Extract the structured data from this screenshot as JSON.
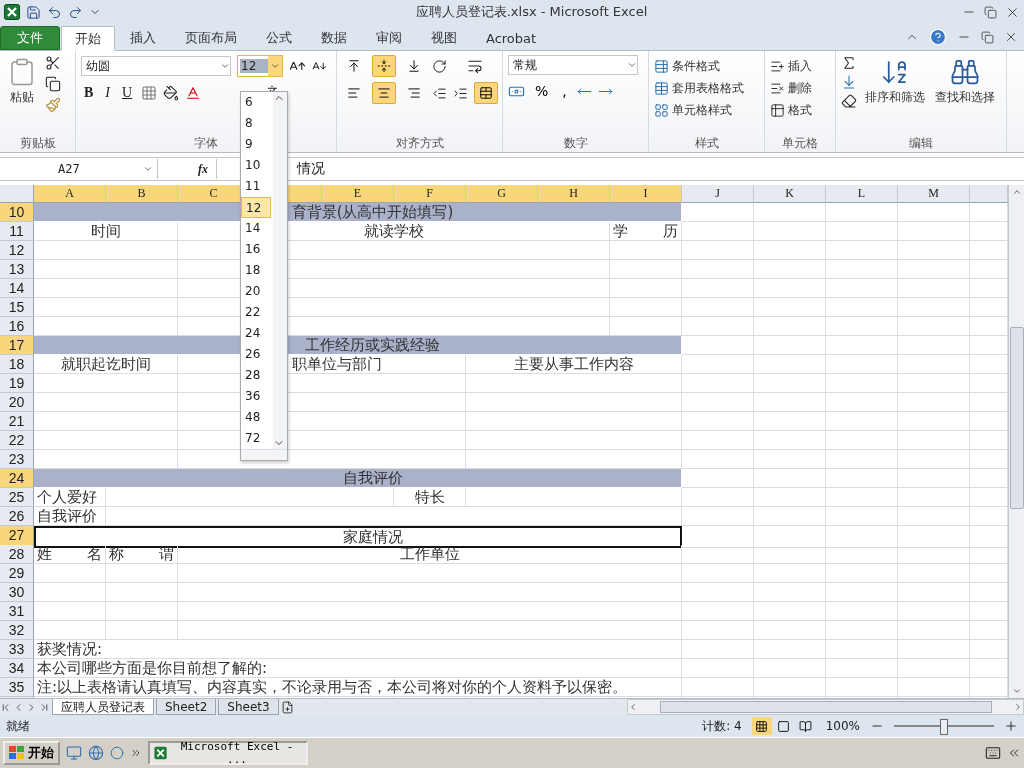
{
  "window": {
    "title": "应聘人员登记表.xlsx - Microsoft Excel"
  },
  "tabs": [
    {
      "label": "文件",
      "kind": "file",
      "selected": false
    },
    {
      "label": "开始",
      "kind": "tab",
      "selected": true
    },
    {
      "label": "插入",
      "kind": "tab",
      "selected": false
    },
    {
      "label": "页面布局",
      "kind": "tab",
      "selected": false
    },
    {
      "label": "公式",
      "kind": "tab",
      "selected": false
    },
    {
      "label": "数据",
      "kind": "tab",
      "selected": false
    },
    {
      "label": "审阅",
      "kind": "tab",
      "selected": false
    },
    {
      "label": "视图",
      "kind": "tab",
      "selected": false
    },
    {
      "label": "Acrobat",
      "kind": "tab",
      "selected": false
    }
  ],
  "ribbon": {
    "clipboard": {
      "paste": "粘贴",
      "label": "剪贴板"
    },
    "font": {
      "name": "幼圆",
      "size": "12",
      "styles": [
        "B",
        "I",
        "U"
      ],
      "label": "字体"
    },
    "alignment": {
      "label": "对齐方式",
      "vertical": [
        {
          "selected": false
        },
        {
          "selected": true
        },
        {
          "selected": false
        }
      ],
      "horizontal": [
        {
          "selected": false
        },
        {
          "selected": true
        },
        {
          "selected": false
        }
      ],
      "merge": {
        "selected": true
      }
    },
    "number": {
      "format": "常规",
      "percent": "%",
      "comma": ",",
      "label": "数字"
    },
    "styles": {
      "items": [
        "条件格式",
        "套用表格格式",
        "单元格样式"
      ],
      "label": "样式"
    },
    "cells": {
      "items": [
        "插入",
        "删除",
        "格式"
      ],
      "label": "单元格"
    },
    "editing": {
      "sort": "排序和筛选",
      "find": "查找和选择",
      "label": "编辑"
    }
  },
  "formula_bar": {
    "name_box": "A27",
    "function_label": "fx",
    "content": "情况"
  },
  "font_size_list": [
    {
      "label": "6",
      "selected": false
    },
    {
      "label": "8",
      "selected": false
    },
    {
      "label": "9",
      "selected": false
    },
    {
      "label": "10",
      "selected": false
    },
    {
      "label": "11",
      "selected": false
    },
    {
      "label": "12",
      "selected": true
    },
    {
      "label": "14",
      "selected": false
    },
    {
      "label": "16",
      "selected": false
    },
    {
      "label": "18",
      "selected": false
    },
    {
      "label": "20",
      "selected": false
    },
    {
      "label": "22",
      "selected": false
    },
    {
      "label": "24",
      "selected": false
    },
    {
      "label": "26",
      "selected": false
    },
    {
      "label": "28",
      "selected": false
    },
    {
      "label": "36",
      "selected": false
    },
    {
      "label": "48",
      "selected": false
    },
    {
      "label": "72",
      "selected": false
    }
  ],
  "columns": [
    {
      "label": "A",
      "selected": true
    },
    {
      "label": "B",
      "selected": true
    },
    {
      "label": "C",
      "selected": true
    },
    {
      "selected": true
    },
    {
      "label": "E",
      "selected": true
    },
    {
      "label": "F",
      "selected": true
    },
    {
      "label": "G",
      "selected": true
    },
    {
      "label": "H",
      "selected": true
    },
    {
      "label": "I",
      "selected": true
    },
    {
      "label": "J",
      "selected": false
    },
    {
      "label": "K",
      "selected": false
    },
    {
      "label": "L",
      "selected": false
    },
    {
      "label": "M",
      "selected": false
    }
  ],
  "rows": [
    {
      "number": "10",
      "selected": true,
      "active": false,
      "kind": "band",
      "cells": [
        "育背景(从高中开始填写)"
      ]
    },
    {
      "number": "11",
      "selected": false,
      "active": false,
      "kind": "education",
      "cells": [
        "时间",
        "就读学校",
        "学 历"
      ]
    },
    {
      "number": "12",
      "selected": false,
      "active": false,
      "kind": "education",
      "cells": []
    },
    {
      "number": "13",
      "selected": false,
      "active": false,
      "kind": "education",
      "cells": []
    },
    {
      "number": "14",
      "selected": false,
      "active": false,
      "kind": "education",
      "cells": []
    },
    {
      "number": "15",
      "selected": false,
      "active": false,
      "kind": "education",
      "cells": []
    },
    {
      "number": "16",
      "selected": false,
      "active": false,
      "kind": "education",
      "cells": []
    },
    {
      "number": "17",
      "selected": true,
      "active": false,
      "kind": "band",
      "cells": [
        "工作经历或实践经验"
      ]
    },
    {
      "number": "18",
      "selected": false,
      "active": false,
      "kind": "work",
      "cells": [
        "就职起讫时间",
        "职单位与部门",
        "主要从事工作内容"
      ]
    },
    {
      "number": "19",
      "selected": false,
      "active": false,
      "kind": "work",
      "cells": []
    },
    {
      "number": "20",
      "selected": false,
      "active": false,
      "kind": "work",
      "cells": []
    },
    {
      "number": "21",
      "selected": false,
      "active": false,
      "kind": "work",
      "cells": []
    },
    {
      "number": "22",
      "selected": false,
      "active": false,
      "kind": "work",
      "cells": []
    },
    {
      "number": "23",
      "selected": false,
      "active": false,
      "kind": "work",
      "cells": []
    },
    {
      "number": "24",
      "selected": true,
      "active": false,
      "kind": "band",
      "cells": [
        "自我评价"
      ]
    },
    {
      "number": "25",
      "selected": false,
      "active": false,
      "kind": "hobby",
      "cells": [
        "个人爱好",
        "特长"
      ]
    },
    {
      "number": "26",
      "selected": false,
      "active": false,
      "kind": "self",
      "cells": [
        "自我评价"
      ]
    },
    {
      "number": "27",
      "selected": true,
      "active": true,
      "kind": "band",
      "cells": [
        "家庭情况"
      ]
    },
    {
      "number": "28",
      "selected": false,
      "active": false,
      "kind": "family",
      "cells": [
        "姓 名",
        "称 谓",
        "工作单位"
      ]
    },
    {
      "number": "29",
      "selected": false,
      "active": false,
      "kind": "family",
      "cells": []
    },
    {
      "number": "30",
      "selected": false,
      "active": false,
      "kind": "family",
      "cells": []
    },
    {
      "number": "31",
      "selected": false,
      "active": false,
      "kind": "family",
      "cells": []
    },
    {
      "number": "32",
      "selected": false,
      "active": false,
      "kind": "family",
      "cells": []
    },
    {
      "number": "33",
      "selected": false,
      "active": false,
      "kind": "note",
      "cells": [
        "获奖情况:"
      ]
    },
    {
      "number": "34",
      "selected": false,
      "active": false,
      "kind": "note",
      "cells": [
        "本公司哪些方面是你目前想了解的:"
      ]
    },
    {
      "number": "35",
      "selected": false,
      "active": false,
      "kind": "note",
      "cells": [
        "注:以上表格请认真填写、内容真实，不论录用与否，本公司将对你的个人资料予以保密。"
      ]
    }
  ],
  "sheets": [
    {
      "label": "应聘人员登记表",
      "selected": true
    },
    {
      "label": "Sheet2",
      "selected": false
    },
    {
      "label": "Sheet3",
      "selected": false
    }
  ],
  "status_bar": {
    "status": "就绪",
    "count": "计数: 4",
    "views": [
      {
        "selected": true
      },
      {
        "selected": false
      },
      {
        "selected": false
      }
    ],
    "zoom": "100%",
    "zoom_level": {
      "level": 0.5
    }
  },
  "taskbar": {
    "start": "开始",
    "task": "Microsoft Excel - ..."
  }
}
